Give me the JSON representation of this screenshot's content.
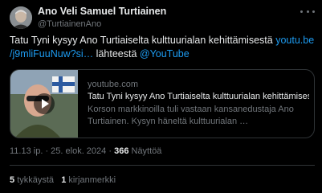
{
  "author": {
    "name": "Ano Veli Samuel Turtiainen",
    "handle": "@TurtiainenAno",
    "avatar_icon": "profile-photo"
  },
  "more_icon": "ellipsis-icon",
  "tweet": {
    "text_before_link": "Tatu Tyni kysyy Ano Turtiaiselta kulttuurialan kehittämisestä ",
    "link_text": "youtu.be /j9mliFuuNuw?si…",
    "text_after_link": " lähteestä ",
    "mention": "@YouTube"
  },
  "card": {
    "domain": "youtube.com",
    "title": "Tatu Tyni kysyy Ano Turtiaiselta kulttuurialan kehittämisestä",
    "description": "Korson markkinoilla tuli vastaan kansanedustaja Ano Turtiainen. Kysyn häneltä kulttuurialan …",
    "play_icon": "play-icon"
  },
  "meta": {
    "time": "11.13 ip.",
    "separator": " · ",
    "date": "25. elok. 2024",
    "views_count": "366",
    "views_label": "Näyttöä"
  },
  "stats": {
    "likes_count": "5",
    "likes_label": "tykkäystä",
    "bookmarks_count": "1",
    "bookmarks_label": "kirjanmerkki"
  },
  "colors": {
    "background": "#000000",
    "text": "#e7e9ea",
    "muted": "#71767b",
    "link": "#1d9bf0",
    "border": "#2f3336"
  }
}
